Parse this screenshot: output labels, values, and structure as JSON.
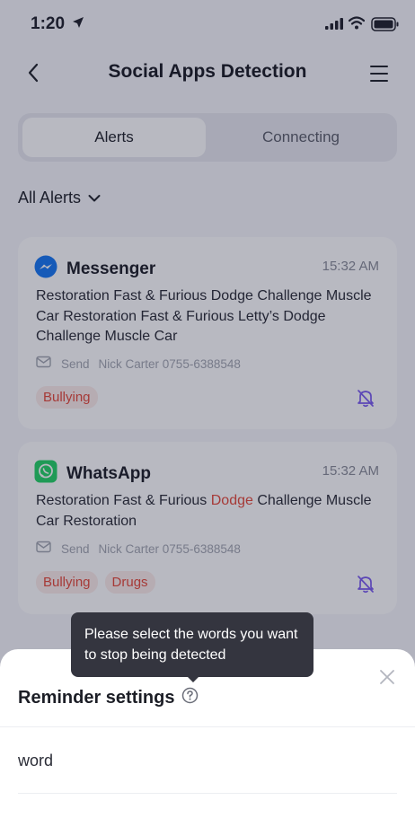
{
  "status_bar": {
    "time": "1:20"
  },
  "nav": {
    "title": "Social Apps Detection"
  },
  "tabs": [
    {
      "label": "Alerts",
      "active": true
    },
    {
      "label": "Connecting",
      "active": false
    }
  ],
  "filter": {
    "label": "All Alerts"
  },
  "alerts": [
    {
      "app": "Messenger",
      "time": "15:32 AM",
      "message": "Restoration Fast & Furious Dodge Challenge Muscle Car Restoration Fast & Furious Letty’s Dodge Challenge Muscle Car",
      "sender_prefix": "Send",
      "sender": "Nick Carter 0755-6388548",
      "tags": [
        "Bullying"
      ]
    },
    {
      "app": "WhatsApp",
      "time": "15:32 AM",
      "message_before": "Restoration Fast & Furious ",
      "message_highlight": "Dodge",
      "message_after": " Challenge Muscle Car Restoration",
      "sender_prefix": "Send",
      "sender": "Nick Carter 0755-6388548",
      "tags": [
        "Bullying",
        "Drugs"
      ]
    }
  ],
  "tooltip": {
    "text": "Please select the words you want to stop being detected"
  },
  "sheet": {
    "title": "Reminder settings",
    "first_item": "word"
  },
  "colors": {
    "accent_tag": "#e5493a",
    "bell": "#7b5cf0",
    "messenger": "#1877f2",
    "whatsapp": "#25d366"
  }
}
